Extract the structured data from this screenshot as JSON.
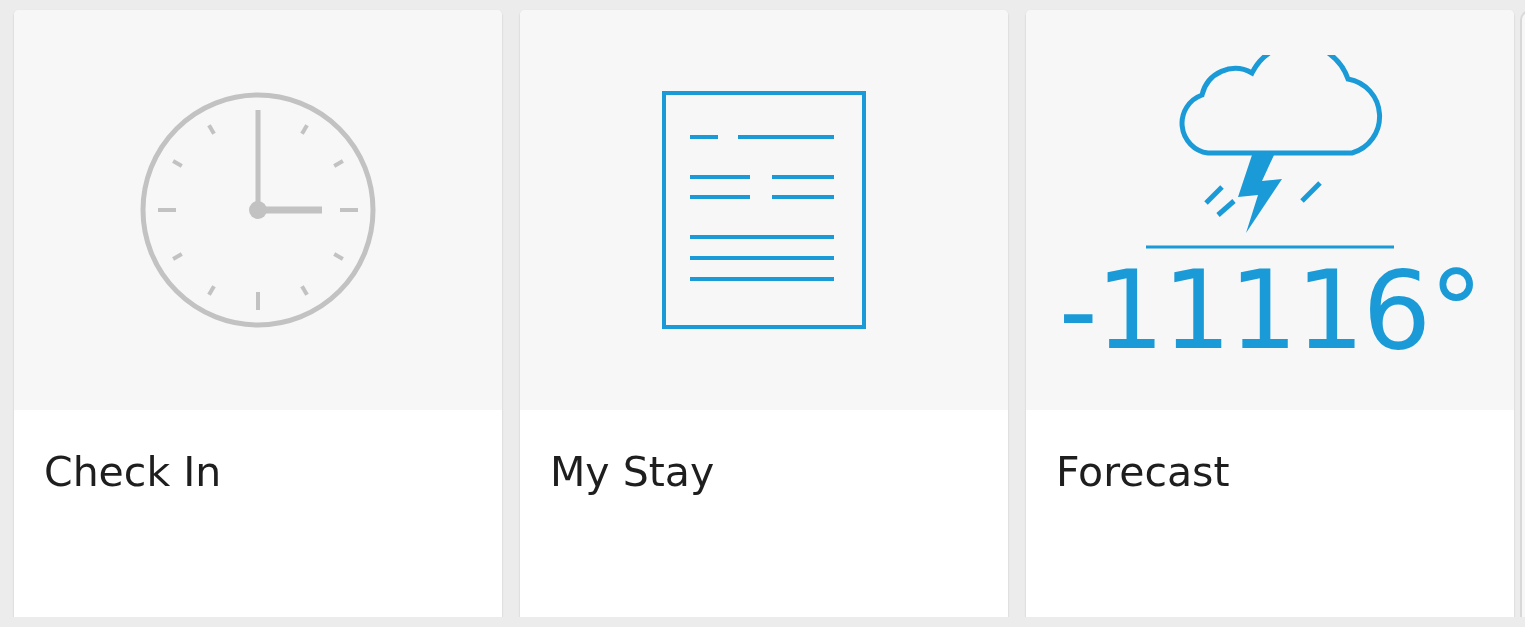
{
  "cards": [
    {
      "kind": "clock",
      "title": "Check In"
    },
    {
      "kind": "document",
      "title": "My Stay"
    },
    {
      "kind": "weather",
      "title": "Forecast",
      "temperature": "-11116°"
    }
  ]
}
